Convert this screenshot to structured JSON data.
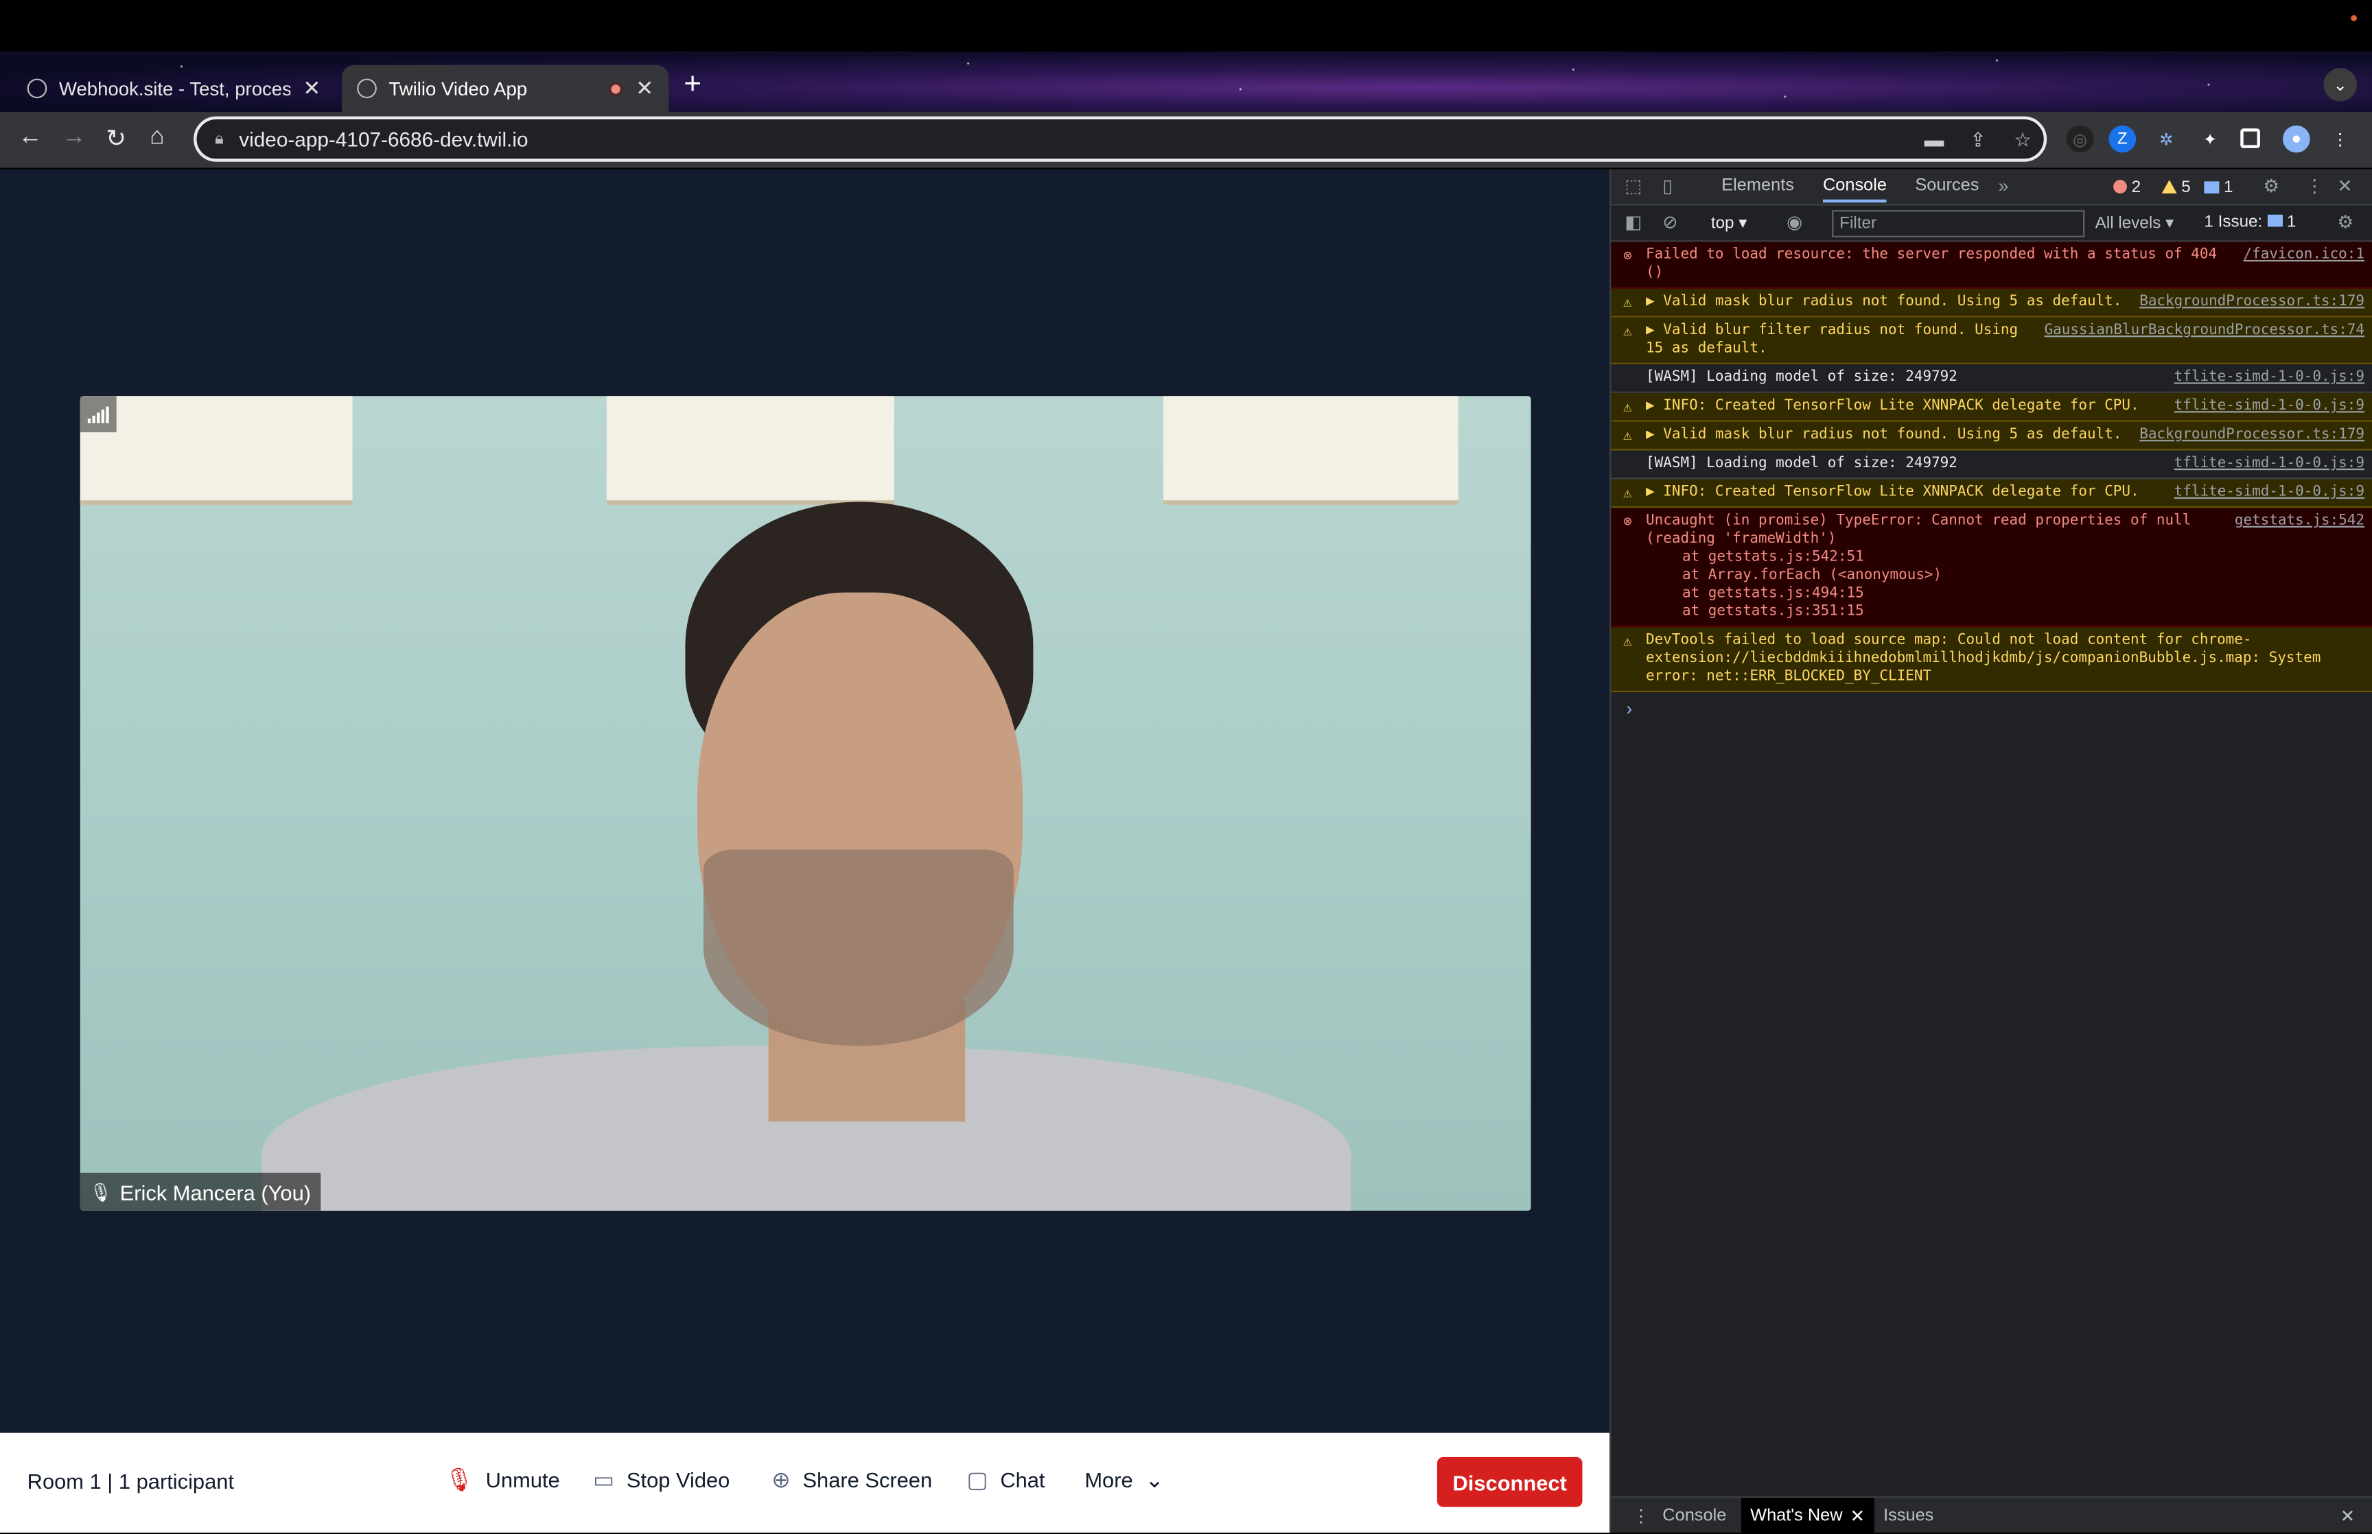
{
  "browser": {
    "tabs": [
      {
        "title": "Webhook.site - Test, process a"
      },
      {
        "title": "Twilio Video App"
      }
    ],
    "new_tab": "+",
    "tab_close": "✕",
    "url": "video-app-4107-6686-dev.twil.io",
    "extension_z": "Z"
  },
  "video": {
    "participant_name": "Erick Mancera (You)"
  },
  "controls": {
    "room_info": "Room 1 | 1 participant",
    "unmute": "Unmute",
    "stop_video": "Stop Video",
    "share_screen": "Share Screen",
    "chat": "Chat",
    "more": "More",
    "disconnect": "Disconnect"
  },
  "devtools": {
    "tabs": [
      "Elements",
      "Console",
      "Sources"
    ],
    "active_tab": "Console",
    "overflow": "»",
    "error_count": "2",
    "warning_count": "5",
    "info_count": "1",
    "context": "top",
    "filter_placeholder": "Filter",
    "levels": "All levels",
    "issues_label": "1 Issue:",
    "issues_count": "1",
    "messages": [
      {
        "level": "error",
        "text": "Failed to load resource: the server responded with a status of 404 ()",
        "source": "/favicon.ico:1"
      },
      {
        "level": "warning",
        "text": "▶ Valid mask blur radius not found. Using 5 as default.",
        "source": "BackgroundProcessor.ts:179"
      },
      {
        "level": "warning",
        "text": "▶ Valid blur filter radius not found. Using 15 as default.",
        "source": "GaussianBlurBackgroundProcessor.ts:74"
      },
      {
        "level": "log",
        "text": "[WASM] Loading model of size: 249792",
        "source": "tflite-simd-1-0-0.js:9"
      },
      {
        "level": "warning",
        "text": "▶ INFO: Created TensorFlow Lite XNNPACK delegate for CPU.",
        "source": "tflite-simd-1-0-0.js:9"
      },
      {
        "level": "warning",
        "text": "▶ Valid mask blur radius not found. Using 5 as default.",
        "source": "BackgroundProcessor.ts:179"
      },
      {
        "level": "log",
        "text": "[WASM] Loading model of size: 249792",
        "source": "tflite-simd-1-0-0.js:9"
      },
      {
        "level": "warning",
        "text": "▶ INFO: Created TensorFlow Lite XNNPACK delegate for CPU.",
        "source": "tflite-simd-1-0-0.js:9"
      },
      {
        "level": "error",
        "text": "Uncaught (in promise) TypeError: Cannot read properties of null (reading 'frameWidth')",
        "source": "getstats.js:542",
        "stack": [
          "at getstats.js:542:51",
          "at Array.forEach (<anonymous>)",
          "at getstats.js:494:15",
          "at getstats.js:351:15"
        ]
      },
      {
        "level": "warning",
        "text": "DevTools failed to load source map: Could not load content for chrome-extension://liecbddmkiiihnedobmlmillhodjkdmb/js/companionBubble.js.map: System error: net::ERR_BLOCKED_BY_CLIENT",
        "source": ""
      }
    ],
    "prompt": "›",
    "drawer_tabs": [
      "Console",
      "What's New",
      "Issues"
    ],
    "drawer_active": "What's New"
  },
  "colors": {
    "app_bg": "#121c2d",
    "disconnect": "#d61f1f",
    "devtools_bg": "#202124"
  }
}
